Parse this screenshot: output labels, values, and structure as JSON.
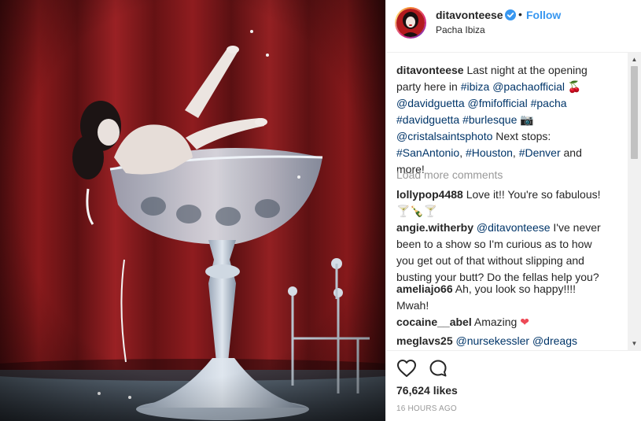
{
  "post": {
    "image_alt": "Performer reclining in a giant crystal champagne glass on a red-curtained stage",
    "username": "ditavonteese",
    "verified": true,
    "separator": "•",
    "follow_label": "Follow",
    "location": "Pacha Ibiza"
  },
  "caption": {
    "username": "ditavonteese",
    "line1": "Last night at the opening",
    "line2_a": "party here in ",
    "line2_tag1": "#ibiza",
    "line2_space": " ",
    "line2_mention": "@pachaofficial",
    "line2_emoji": " 🍒",
    "line3_m1": "@davidguetta",
    "line3_m2": "@fmifofficial",
    "line3_tag": "#pacha",
    "line4_tag1": "#davidguetta",
    "line4_tag2": "#burlesque",
    "line4_emoji": "📷",
    "line5_mention": "@cristalsaintsphoto",
    "line5_text": " Next stops:",
    "line6_tag1": "#SanAntonio",
    "line6_tag2": "#Houston",
    "line6_tag3": "#Denver",
    "line6_end": " and",
    "line7": "more!"
  },
  "load_more_label": "Load more comments",
  "comments": [
    {
      "username": "lollypop4488",
      "text": "Love it!! You're so fabulous!",
      "text2": "🍸🍾🍸"
    },
    {
      "username": "angie.witherby",
      "mention": "@ditavonteese",
      "text": " I've never",
      "text2": "been to a show so I'm curious as to how",
      "text3": "you get out of that without slipping and",
      "text4": "busting your butt? Do the fellas help you?"
    },
    {
      "username": "ameliajo66",
      "text": "Ah, you look so happy!!!!",
      "text2": "Mwah!"
    },
    {
      "username": "cocaine__abel",
      "text": "Amazing",
      "emoji": "❤"
    },
    {
      "username": "meglavs25",
      "mention1": "@nursekessler",
      "mention2": "@dreags"
    }
  ],
  "likes": "76,624 likes",
  "timestamp": "16 HOURS AGO",
  "icons": {
    "like": "heart-icon",
    "comment": "comment-bubble-icon",
    "verified": "verified-badge-icon"
  },
  "colors": {
    "link": "#003569",
    "follow": "#3897f0",
    "verified": "#3897f0",
    "muted": "#999999"
  }
}
